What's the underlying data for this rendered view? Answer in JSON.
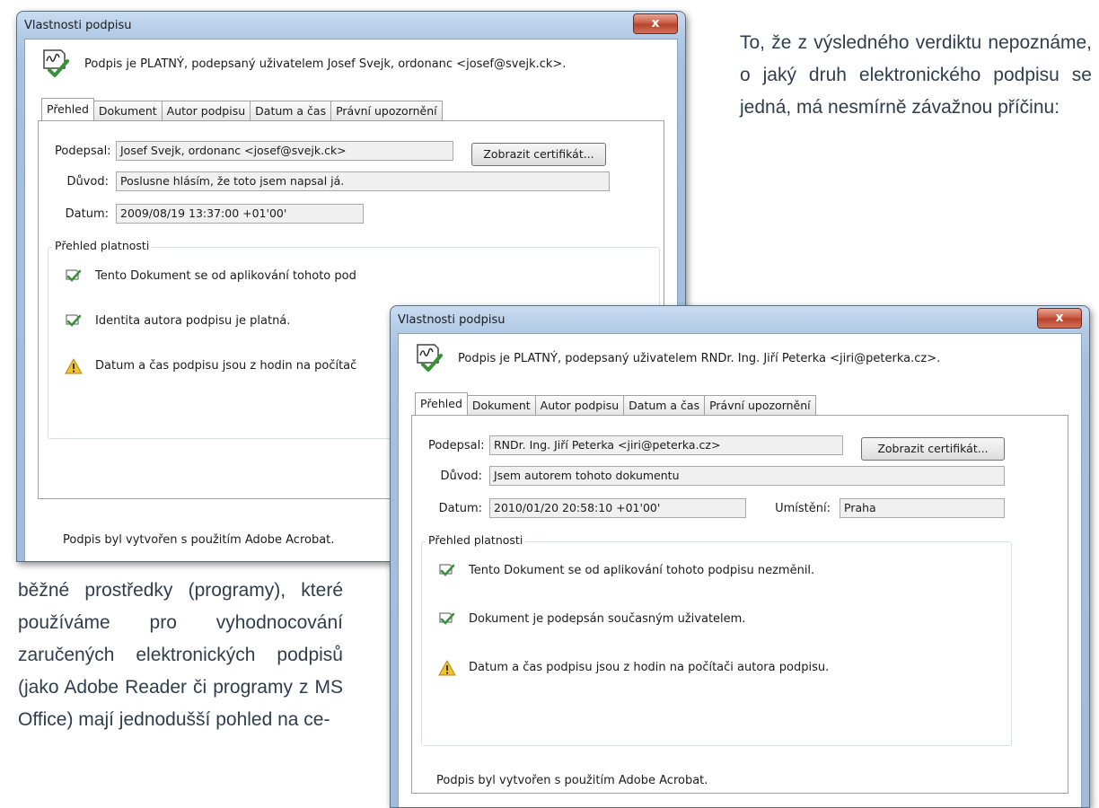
{
  "text": {
    "paragraph_top": "To, že z výsledného verdiktu nepoznáme, o jaký druh elektronického podpisu se jedná, má nesmírně závažnou příčinu:",
    "paragraph_bottom": "běžné prostředky (programy), které používáme pro vyhodnocování zaručených elektronických podpisů (jako Adobe Reader či programy z MS Office) mají jednodušší pohled na ce-"
  },
  "dialog_a": {
    "title": "Vlastnosti podpisu",
    "close_label": "x",
    "headline": "Podpis je PLATNÝ, podepsaný uživatelem Josef Svejk, ordonanc <josef@svejk.ck>.",
    "tabs": [
      "Přehled",
      "Dokument",
      "Autor podpisu",
      "Datum a čas",
      "Právní upozornění"
    ],
    "labels": {
      "signed_by": "Podepsal:",
      "reason": "Důvod:",
      "date": "Datum:"
    },
    "signed_by": "Josef Svejk, ordonanc <josef@svejk.ck>",
    "show_cert_label": "Zobrazit certifikát...",
    "reason": "Poslusne hlásím, že toto jsem napsal já.",
    "date": "2009/08/19 13:37:00 +01'00'",
    "validity_title": "Přehled platnosti",
    "validity": [
      {
        "icon": "valid-signature-icon",
        "text": "Tento Dokument se od aplikování tohoto pod"
      },
      {
        "icon": "valid-signature-icon",
        "text": "Identita autora podpisu je platná."
      },
      {
        "icon": "warning-icon",
        "text": "Datum a čas podpisu jsou z hodin na počítač"
      }
    ],
    "footer": "Podpis byl vytvořen s použitím Adobe Acrobat."
  },
  "dialog_b": {
    "title": "Vlastnosti podpisu",
    "close_label": "x",
    "headline": "Podpis je PLATNÝ, podepsaný uživatelem RNDr. Ing. Jiří Peterka <jiri@peterka.cz>.",
    "tabs": [
      "Přehled",
      "Dokument",
      "Autor podpisu",
      "Datum a čas",
      "Právní upozornění"
    ],
    "labels": {
      "signed_by": "Podepsal:",
      "reason": "Důvod:",
      "date": "Datum:",
      "location": "Umístění:"
    },
    "signed_by": "RNDr. Ing. Jiří Peterka <jiri@peterka.cz>",
    "show_cert_label": "Zobrazit certifikát...",
    "reason": "Jsem autorem tohoto dokumentu",
    "date": "2010/01/20 20:58:10 +01'00'",
    "location": "Praha",
    "validity_title": "Přehled platnosti",
    "validity": [
      {
        "icon": "valid-signature-icon",
        "text": "Tento Dokument se od aplikování tohoto podpisu nezměnil."
      },
      {
        "icon": "valid-signature-icon",
        "text": "Dokument je podepsán současným uživatelem."
      },
      {
        "icon": "warning-icon",
        "text": "Datum a čas podpisu jsou z hodin na počítači autora podpisu."
      }
    ],
    "footer": "Podpis byl vytvořen s použitím Adobe Acrobat."
  },
  "colors": {
    "paragraph_text": "#2f3d4d",
    "window_frame": "#a6c0df",
    "close_button": "#c8553c",
    "valid_check": "#3a8f3a",
    "warning": "#f2c12e"
  }
}
